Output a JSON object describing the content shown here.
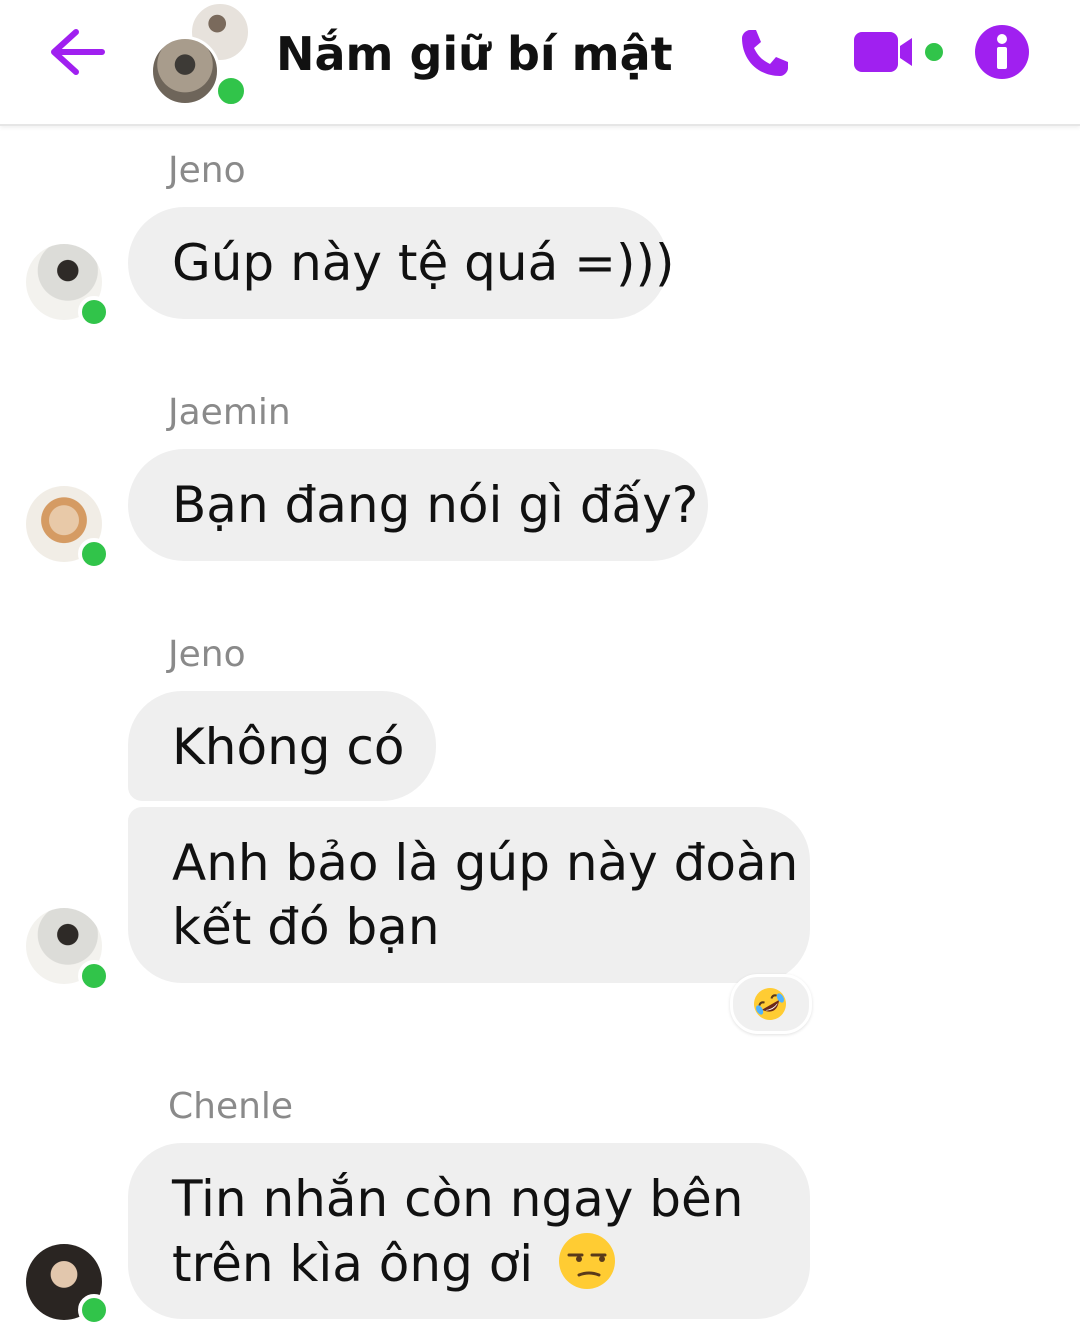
{
  "header": {
    "title": "Nắm giữ bí mật",
    "icons": {
      "back": "arrow-left-icon",
      "call": "phone-icon",
      "video": "video-camera-icon",
      "info": "info-icon"
    },
    "accent_color": "#a020f0",
    "online_color": "#31c44a"
  },
  "messages": [
    {
      "sender": "Jeno",
      "text": "Gúp này tệ quá =)))"
    },
    {
      "sender": "Jaemin",
      "text": "Bạn đang nói gì đấy?"
    },
    {
      "sender": "Jeno",
      "lines": [
        "Không có"
      ]
    },
    {
      "lines": [
        "Anh bảo là gúp này đoàn",
        "kết đó bạn"
      ],
      "reaction": "rolling-on-floor-laughing-emoji"
    },
    {
      "sender": "Chenle",
      "lines": [
        "Tin nhắn còn ngay bên",
        "trên kìa ông ơi"
      ],
      "trailing_emoji": "unamused-face-emoji"
    }
  ],
  "colors": {
    "bubble_bg": "#efefef",
    "sender_name": "#8a8a8a",
    "text": "#111111"
  }
}
